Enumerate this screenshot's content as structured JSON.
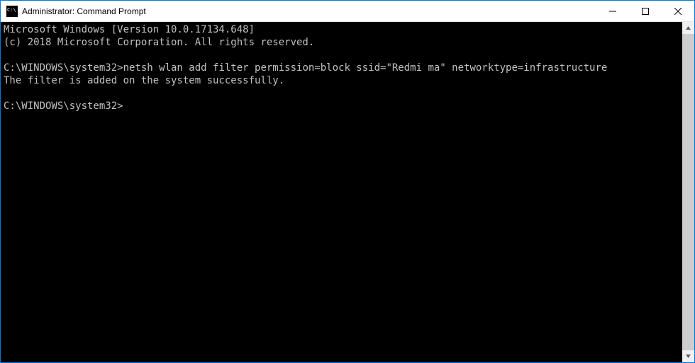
{
  "window": {
    "title": "Administrator: Command Prompt"
  },
  "terminal": {
    "line1": "Microsoft Windows [Version 10.0.17134.648]",
    "line2": "(c) 2018 Microsoft Corporation. All rights reserved.",
    "blank1": "",
    "prompt1_path": "C:\\WINDOWS\\system32>",
    "command1": "netsh wlan add filter permission=block ssid=\"Redmi ma\" networktype=infrastructure",
    "response1": "The filter is added on the system successfully.",
    "blank2": "",
    "prompt2_path": "C:\\WINDOWS\\system32>",
    "cursor": ""
  }
}
